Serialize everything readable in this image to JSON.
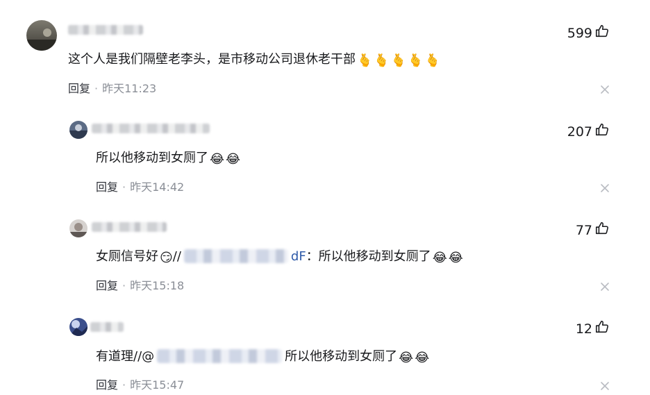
{
  "comments": [
    {
      "text": "这个人是我们隔壁老李头，是市移动公司退休老干部",
      "emojis": [
        "🫰",
        "🫰",
        "🫰",
        "🫰",
        "🫰"
      ],
      "reply_label": "回复",
      "dot": "·",
      "time": "昨天11:23",
      "likes": "599"
    },
    {
      "text": "所以他移动到女厕了",
      "emojis": [
        "😂",
        "😂"
      ],
      "reply_label": "回复",
      "dot": "·",
      "time": "昨天14:42",
      "likes": "207"
    },
    {
      "text_before": "女厕信号好",
      "emoji_mid": "😏",
      "slashes": "//",
      "mention_tail": "dF",
      "text_after": "：所以他移动到女厕了",
      "emojis": [
        "😂",
        "😂"
      ],
      "reply_label": "回复",
      "dot": "·",
      "time": "昨天15:18",
      "likes": "77"
    },
    {
      "text_before": "有道理//@",
      "text_after": "所以他移动到女厕了",
      "emojis": [
        "😂",
        "😂"
      ],
      "reply_label": "回复",
      "dot": "·",
      "time": "昨天15:47",
      "likes": "12"
    }
  ],
  "icons": {
    "like": "thumbs-up-icon",
    "close": "close-icon"
  },
  "colors": {
    "text": "#18191c",
    "meta": "#8a8e96",
    "mention": "#2e5aa8",
    "close": "#b9bcc2"
  }
}
